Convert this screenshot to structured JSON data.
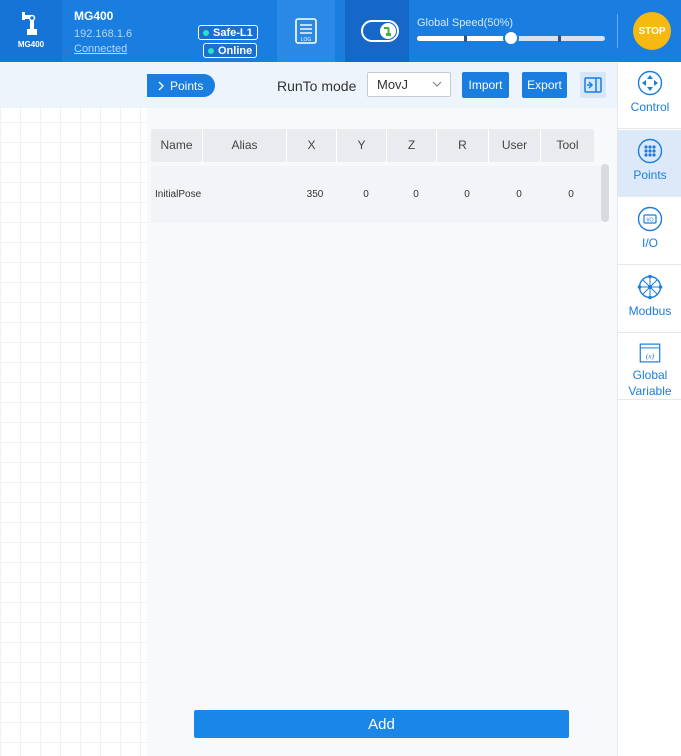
{
  "header": {
    "robot_model_small": "MG400",
    "device_name": "MG400",
    "ip": "192.168.1.6",
    "connection_status": "Connected",
    "safety_level": "Safe-L1",
    "online_status": "Online",
    "log_icon": "log-icon",
    "speed_label": "Global Speed(50%)",
    "speed_percent": 50,
    "stop_label": "STOP",
    "colors": {
      "header_bg": "#1a7de0",
      "stop": "#f5b90f",
      "status_dot": "#29e0c8"
    }
  },
  "toolbar": {
    "points_tab": "Points",
    "runto_label": "RunTo mode",
    "runto_value": "MovJ",
    "import_label": "Import",
    "export_label": "Export"
  },
  "table": {
    "columns": [
      "Name",
      "Alias",
      "X",
      "Y",
      "Z",
      "R",
      "User",
      "Tool"
    ],
    "rows": [
      {
        "name": "InitialPose",
        "alias": "",
        "x": "350",
        "y": "0",
        "z": "0",
        "r": "0",
        "user": "0",
        "tool": "0"
      }
    ]
  },
  "add_label": "Add",
  "sidebar": {
    "items": [
      {
        "label": "Control",
        "icon": "control-icon"
      },
      {
        "label": "Points",
        "icon": "points-icon",
        "active": true
      },
      {
        "label": "I/O",
        "icon": "io-icon"
      },
      {
        "label": "Modbus",
        "icon": "modbus-icon"
      },
      {
        "label": "Global\nVariable",
        "icon": "global-variable-icon"
      }
    ]
  }
}
